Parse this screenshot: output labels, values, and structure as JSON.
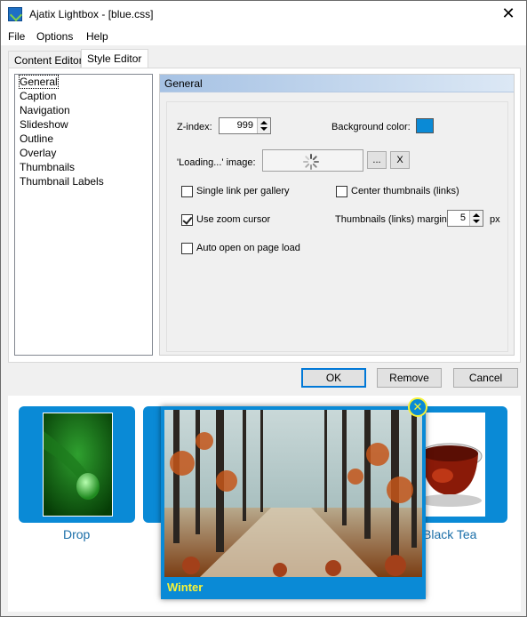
{
  "window": {
    "title": "Ajatix Lightbox - [blue.css]"
  },
  "menu": {
    "file": "File",
    "options": "Options",
    "help": "Help"
  },
  "tabs": [
    {
      "label": "Content Editor"
    },
    {
      "label": "Style Editor"
    }
  ],
  "list": {
    "items": [
      {
        "label": "General"
      },
      {
        "label": "Caption"
      },
      {
        "label": "Navigation"
      },
      {
        "label": "Slideshow"
      },
      {
        "label": "Outline"
      },
      {
        "label": "Overlay"
      },
      {
        "label": "Thumbnails"
      },
      {
        "label": "Thumbnail Labels"
      }
    ],
    "selected": "General"
  },
  "general": {
    "header": "General",
    "zindex_label": "Z-index:",
    "zindex_value": "999",
    "bgcolor_label": "Background color:",
    "bgcolor_value": "#0a8ad6",
    "loading_label": "'Loading...' image:",
    "browse_label": "...",
    "clear_label": "X",
    "single_link_label": "Single link per gallery",
    "single_link_checked": false,
    "center_thumbs_label": "Center thumbnails (links)",
    "center_thumbs_checked": false,
    "zoom_cursor_label": "Use zoom cursor",
    "zoom_cursor_checked": true,
    "margin_label": "Thumbnails (links) margin:",
    "margin_value": "5",
    "margin_unit": "px",
    "auto_open_label": "Auto open on page load",
    "auto_open_checked": false
  },
  "buttons": {
    "ok": "OK",
    "remove": "Remove",
    "cancel": "Cancel"
  },
  "preview": {
    "thumbnails": [
      {
        "caption": "Drop"
      },
      {
        "caption": "Black Tea"
      }
    ],
    "lightbox_caption": "Winter",
    "accent_color": "#0a8ad6",
    "caption_color": "#f7f338"
  }
}
